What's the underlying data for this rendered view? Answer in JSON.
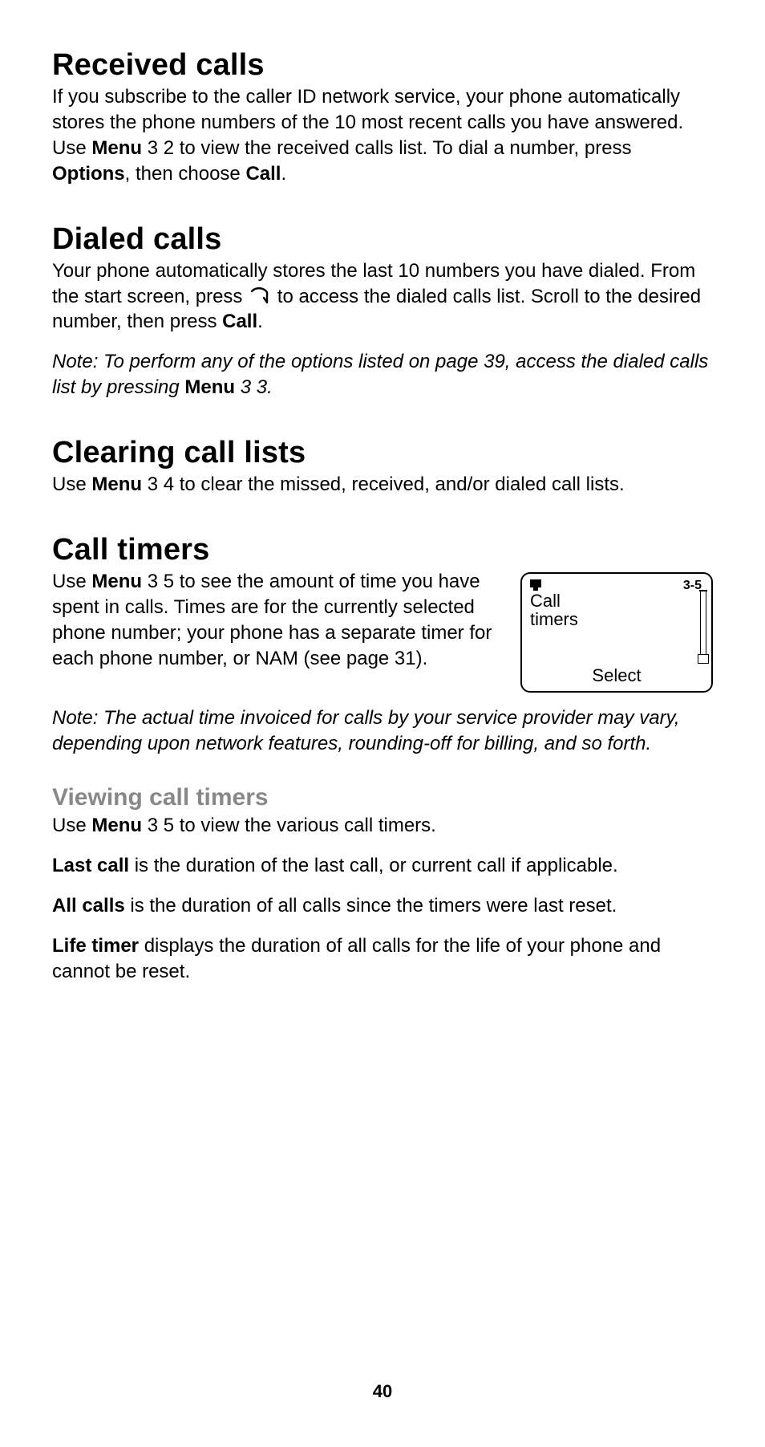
{
  "sections": {
    "received": {
      "heading": "Received calls",
      "p1a": "If you subscribe to the caller ID network service, your phone automatically stores the phone numbers of the 10 most recent calls you have answered. Use ",
      "p1_menu": "Menu",
      "p1b": " 3 2 to view the received calls list. To dial a number, press ",
      "p1_options": "Options",
      "p1c": ", then choose ",
      "p1_call": "Call",
      "p1d": "."
    },
    "dialed": {
      "heading": "Dialed calls",
      "p1a": "Your phone automatically stores the last 10 numbers you have dialed. From the start screen, press ",
      "p1b": " to access the dialed calls list. Scroll to the desired number, then press ",
      "p1_call": "Call",
      "p1c": ".",
      "note_a": "Note:  To perform any of the options listed on page 39, access the dialed calls list by pressing ",
      "note_menu": "Menu",
      "note_b": " 3 3."
    },
    "clearing": {
      "heading": "Clearing call lists",
      "p1a": "Use ",
      "p1_menu": "Menu",
      "p1b": " 3 4 to clear the missed, received, and/or dialed call lists."
    },
    "timers": {
      "heading": "Call timers",
      "p1a": "Use ",
      "p1_menu": "Menu",
      "p1b": " 3 5 to see the amount of time you have spent in calls. Times are for the currently selected phone number; your phone has a separate timer for each phone number, or NAM (see page 31).",
      "note": "Note:  The actual time invoiced for calls by your service provider may vary, depending upon network features, rounding-off for billing, and so forth."
    },
    "viewing": {
      "heading": "Viewing call timers",
      "p1a": "Use ",
      "p1_menu": "Menu",
      "p1b": " 3 5 to view the various call timers.",
      "p2_bold": "Last call",
      "p2_rest": " is the duration of the last call, or current call if applicable.",
      "p3_bold": "All calls",
      "p3_rest": " is the duration of all calls since the timers were last reset.",
      "p4_bold": "Life timer",
      "p4_rest": " displays the duration of all calls for the life of your phone and cannot be reset."
    }
  },
  "phone_screen": {
    "menu_num": "3-5",
    "title_line1": "Call",
    "title_line2": "timers",
    "softkey": "Select"
  },
  "page_number": "40"
}
